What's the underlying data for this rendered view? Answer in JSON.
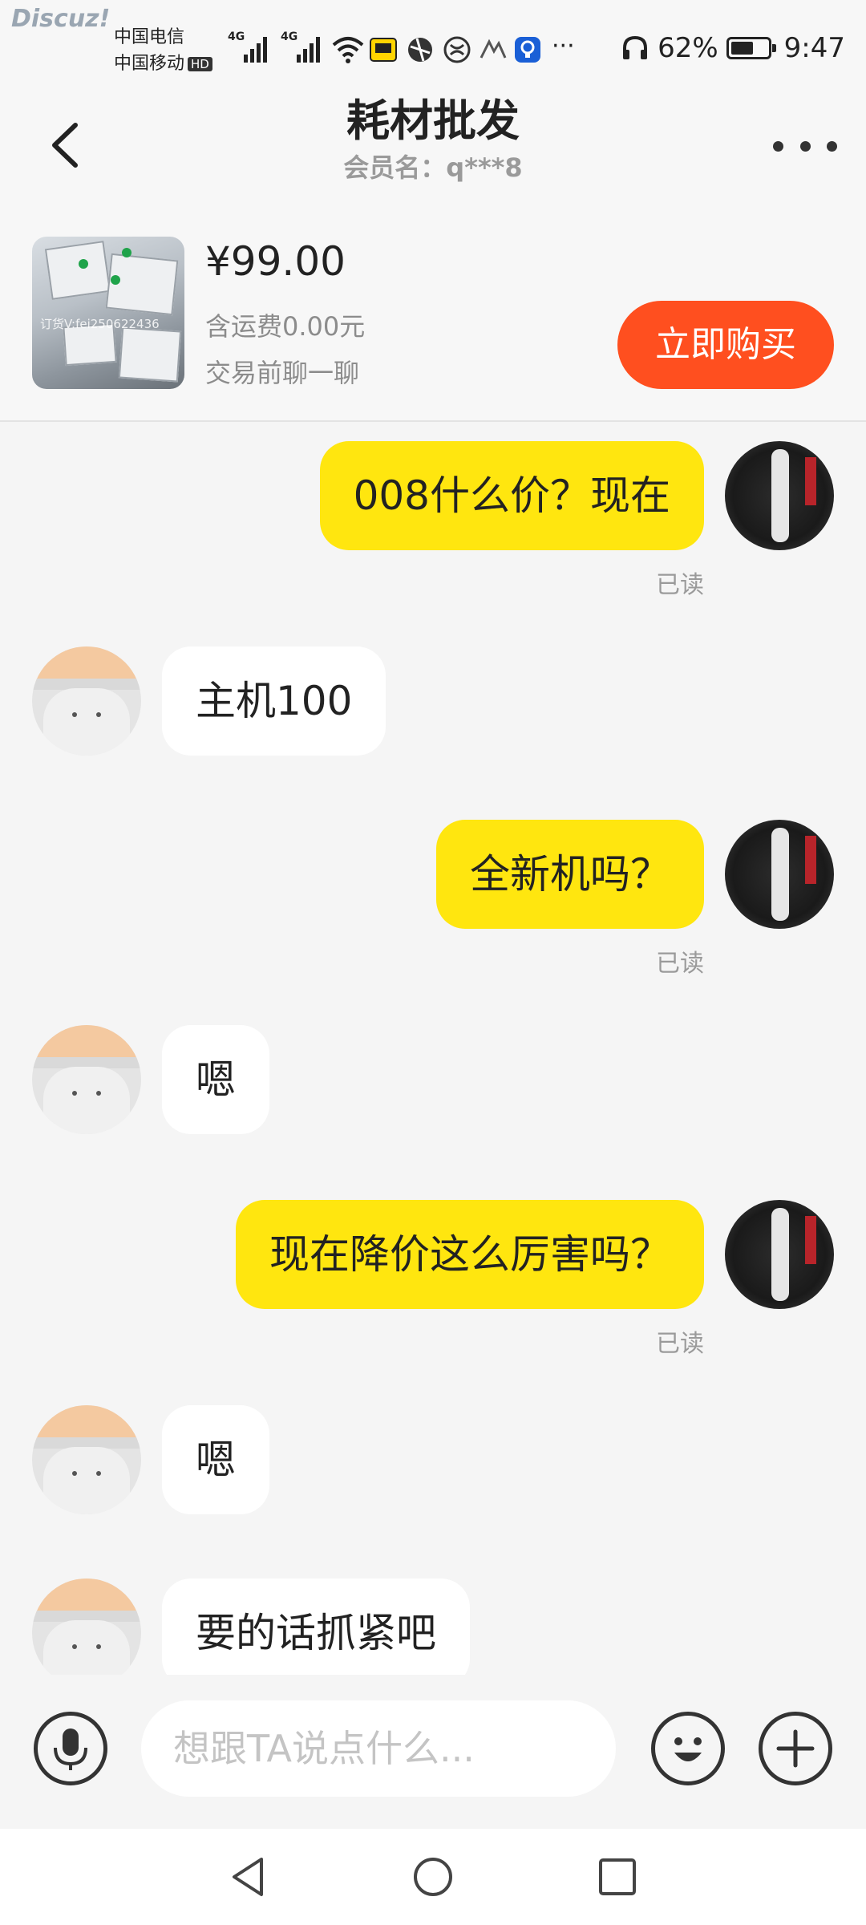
{
  "status_bar": {
    "watermark": "Discuz!",
    "carrier_1": "中国电信",
    "carrier_2": "中国移动",
    "hd": "HD",
    "signal_1": "4G",
    "signal_2": "4G",
    "more": "···",
    "battery": "62%",
    "battery_level": 0.62,
    "time": "9:47"
  },
  "header": {
    "title": "耗材批发",
    "subtitle": "会员名：q***8"
  },
  "product": {
    "thumb_watermark": "订货V:fei250622436",
    "price": "¥99.00",
    "shipping": "含运费0.00元",
    "hint": "交易前聊一聊",
    "buy_label": "立即购买",
    "buy_color": "#ff4f1f"
  },
  "messages": [
    {
      "from": "me",
      "text": "008什么价？现在",
      "status": "已读"
    },
    {
      "from": "them",
      "text": "主机100"
    },
    {
      "from": "me",
      "text": "全新机吗？",
      "status": "已读"
    },
    {
      "from": "them",
      "text": "嗯"
    },
    {
      "from": "me",
      "text": "现在降价这么厉害吗？",
      "status": "已读"
    },
    {
      "from": "them",
      "text": "嗯"
    },
    {
      "from": "them",
      "text": "要的话抓紧吧"
    }
  ],
  "input_bar": {
    "placeholder": "想跟TA说点什么...",
    "icons": [
      "microphone-icon",
      "emoji-icon",
      "plus-icon"
    ]
  },
  "colors": {
    "my_bubble": "#ffe60f",
    "their_bubble": "#ffffff",
    "background": "#f5f5f5"
  }
}
